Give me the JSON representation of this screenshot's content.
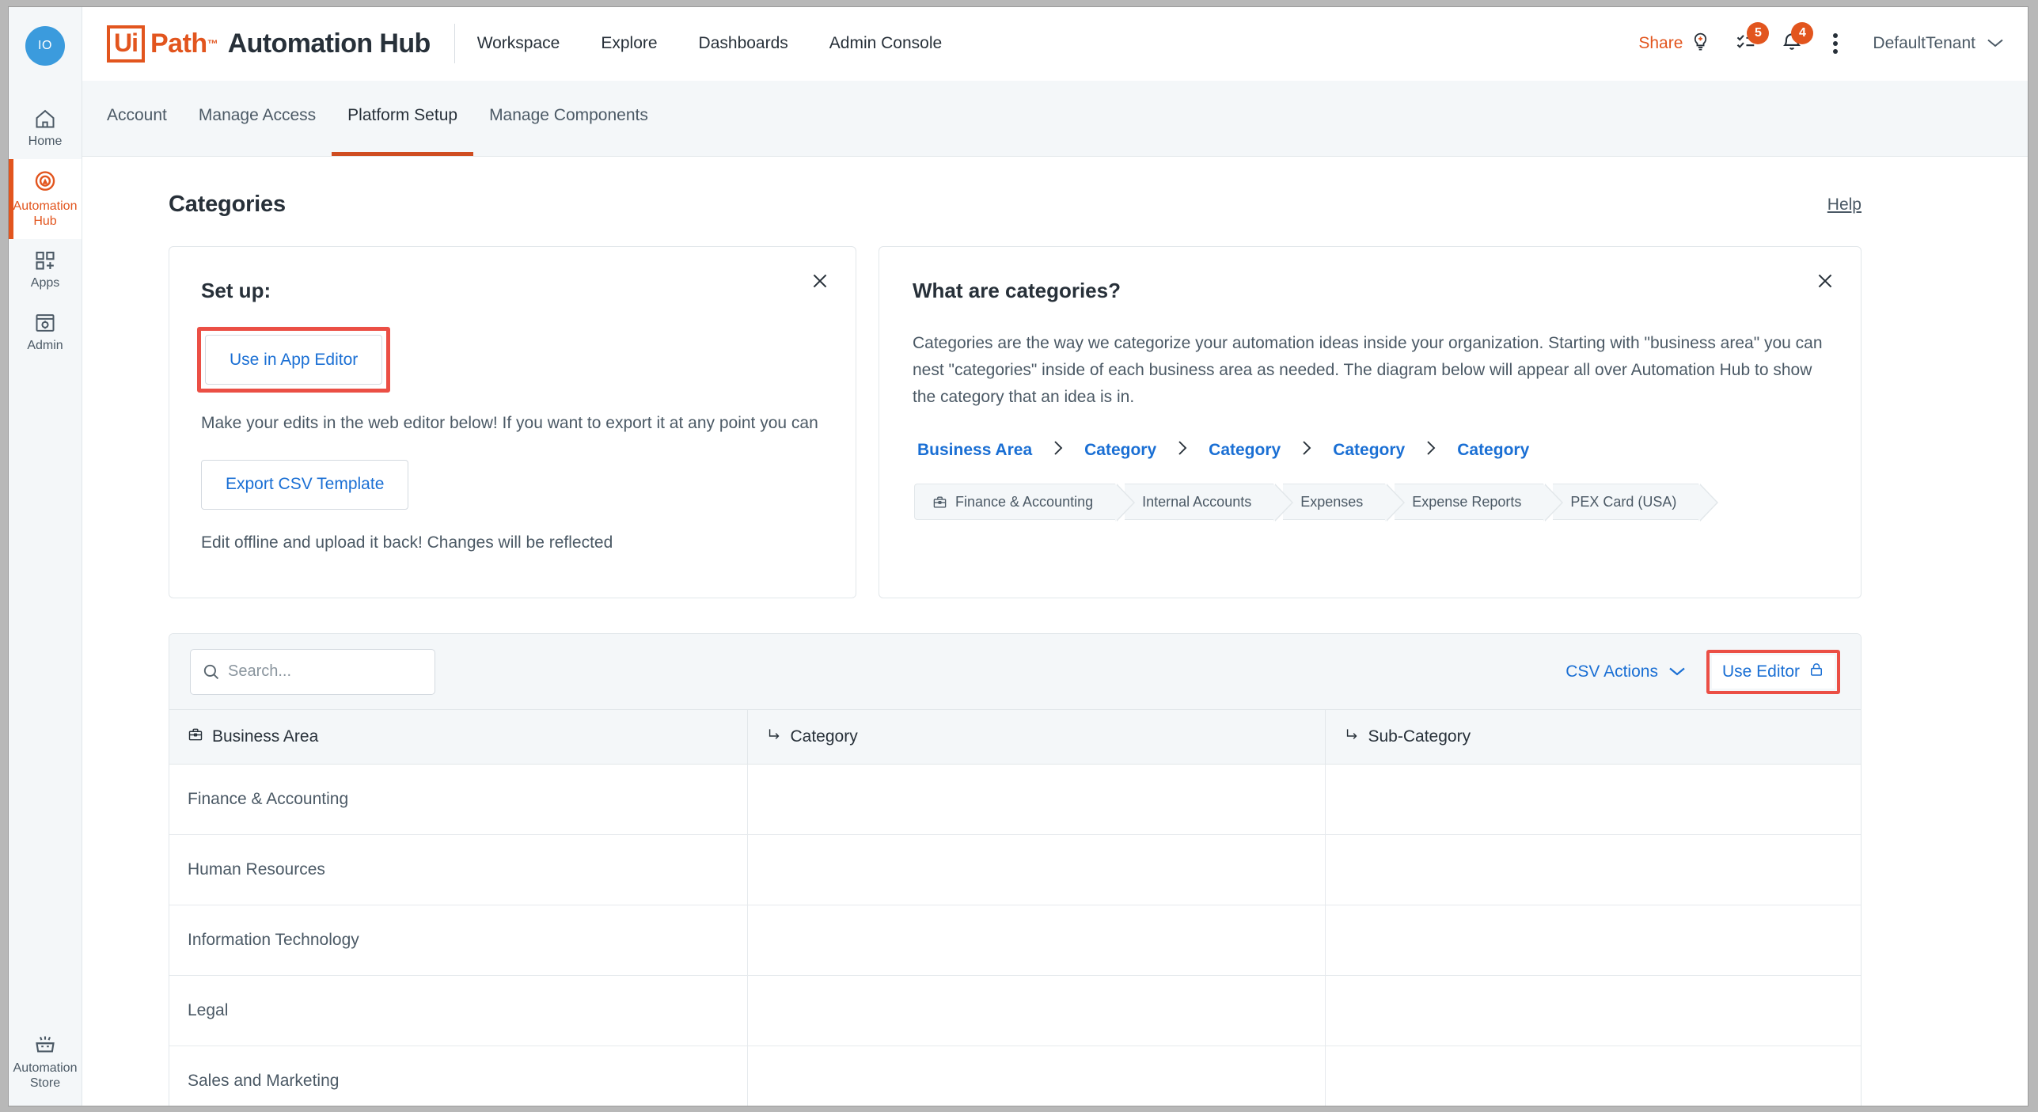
{
  "sidebar": {
    "avatar_initials": "IO",
    "items": [
      {
        "label": "Home",
        "icon": "home-icon",
        "active": false
      },
      {
        "label": "Automation Hub",
        "icon": "automation-hub-icon",
        "active": true
      },
      {
        "label": "Apps",
        "icon": "apps-icon",
        "active": false
      },
      {
        "label": "Admin",
        "icon": "admin-icon",
        "active": false
      }
    ],
    "bottom_items": [
      {
        "label": "Automation Store",
        "icon": "automation-store-icon"
      }
    ]
  },
  "header": {
    "logo_ui": "Ui",
    "logo_path": "Path",
    "logo_tm": "™",
    "logo_title": "Automation Hub",
    "nav": [
      {
        "label": "Workspace"
      },
      {
        "label": "Explore"
      },
      {
        "label": "Dashboards"
      },
      {
        "label": "Admin Console"
      }
    ],
    "share_label": "Share",
    "share_icon": "lightbulb-plus-icon",
    "tasks_icon": "checklist-icon",
    "tasks_badge": "5",
    "notifications_icon": "bell-icon",
    "notifications_badge": "4",
    "more_icon": "kebab-menu-icon",
    "tenant_label": "DefaultTenant",
    "tenant_chevron": "chevron-down-icon"
  },
  "tabs": [
    {
      "label": "Account",
      "active": false
    },
    {
      "label": "Manage Access",
      "active": false
    },
    {
      "label": "Platform Setup",
      "active": true
    },
    {
      "label": "Manage Components",
      "active": false
    }
  ],
  "page": {
    "title": "Categories",
    "help_label": "Help"
  },
  "setup_card": {
    "title": "Set up:",
    "close_icon": "close-icon",
    "primary_button": "Use in App Editor",
    "body_text": "Make your edits in the web editor below! If you want to export it at any point you can",
    "secondary_button": "Export CSV Template",
    "footer_text": "Edit offline and upload it back! Changes will be reflected",
    "highlight_color": "#eb4f45"
  },
  "info_card": {
    "title": "What are categories?",
    "close_icon": "close-icon",
    "body_text": "Categories are the way we categorize your automation ideas inside your organization. Starting with \"business area\" you can nest \"categories\" inside of each business area as needed. The diagram below will appear all over Automation Hub to show the category that an idea is in.",
    "chain": [
      {
        "label": "Business Area"
      },
      {
        "label": "Category"
      },
      {
        "label": "Category"
      },
      {
        "label": "Category"
      },
      {
        "label": "Category"
      }
    ],
    "chain_separator": "›",
    "breadcrumb": [
      {
        "label": "Finance & Accounting",
        "icon": "briefcase-icon"
      },
      {
        "label": "Internal Accounts",
        "icon": ""
      },
      {
        "label": "Expenses",
        "icon": ""
      },
      {
        "label": "Expense Reports",
        "icon": ""
      },
      {
        "label": "PEX Card (USA)",
        "icon": ""
      }
    ]
  },
  "toolbar": {
    "search_placeholder": "Search...",
    "search_value": "",
    "search_icon": "search-icon",
    "csv_actions_label": "CSV Actions",
    "csv_actions_icon": "chevron-down-icon",
    "use_editor_label": "Use Editor",
    "use_editor_icon": "lock-icon",
    "use_editor_highlight_color": "#eb4f45"
  },
  "table": {
    "columns": [
      {
        "label": "Business Area",
        "icon": "briefcase-icon"
      },
      {
        "label": "Category",
        "icon": "arrow-turn-down-right-icon"
      },
      {
        "label": "Sub-Category",
        "icon": "arrow-turn-down-right-icon"
      }
    ],
    "rows": [
      {
        "business_area": "Finance & Accounting",
        "category": "",
        "sub_category": ""
      },
      {
        "business_area": "Human Resources",
        "category": "",
        "sub_category": ""
      },
      {
        "business_area": "Information Technology",
        "category": "",
        "sub_category": ""
      },
      {
        "business_area": "Legal",
        "category": "",
        "sub_category": ""
      },
      {
        "business_area": "Sales and Marketing",
        "category": "",
        "sub_category": ""
      }
    ]
  },
  "colors": {
    "brand_orange": "#e2551e",
    "link_blue": "#1a6fd4",
    "highlight_red": "#eb4f45",
    "panel_bg": "#f4f7f9",
    "text_dark": "#273039",
    "text_muted": "#4b5965"
  }
}
